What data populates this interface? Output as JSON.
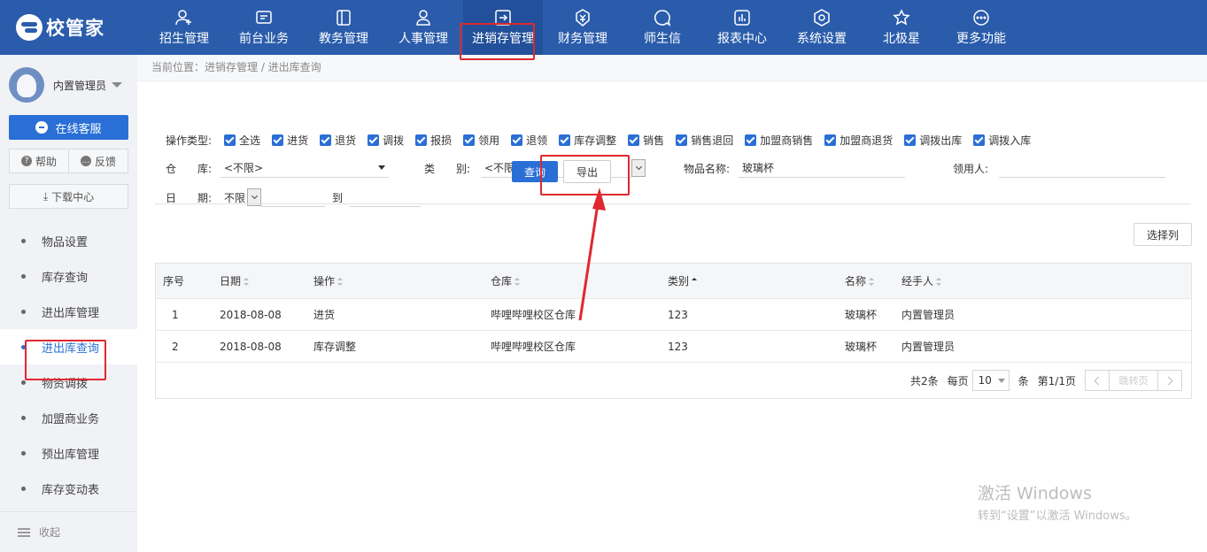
{
  "app": {
    "logo_text": "校管家"
  },
  "nav": [
    {
      "label": "招生管理",
      "icon": "add-user-icon"
    },
    {
      "label": "前台业务",
      "icon": "screen-icon"
    },
    {
      "label": "教务管理",
      "icon": "book-icon"
    },
    {
      "label": "人事管理",
      "icon": "person-icon"
    },
    {
      "label": "进销存管理",
      "icon": "exchange-icon",
      "active": true
    },
    {
      "label": "财务管理",
      "icon": "yuan-shield-icon"
    },
    {
      "label": "师生信",
      "icon": "chat-icon"
    },
    {
      "label": "报表中心",
      "icon": "report-icon"
    },
    {
      "label": "系统设置",
      "icon": "gear-icon"
    },
    {
      "label": "北极星",
      "icon": "star-icon"
    },
    {
      "label": "更多功能",
      "icon": "more-icon"
    }
  ],
  "sidebar": {
    "user_name": "内置管理员",
    "service_label": "在线客服",
    "help_label": "帮助",
    "feedback_label": "反馈",
    "download_label": "下载中心",
    "menu": [
      {
        "label": "物品设置"
      },
      {
        "label": "库存查询"
      },
      {
        "label": "进出库管理"
      },
      {
        "label": "进出库查询",
        "active": true
      },
      {
        "label": "物资调拨"
      },
      {
        "label": "加盟商业务"
      },
      {
        "label": "预出库管理"
      },
      {
        "label": "库存变动表"
      }
    ],
    "collapse_label": "收起"
  },
  "breadcrumb": "当前位置：进销存管理 / 进出库查询",
  "filters": {
    "op_type_label": "操作类型:",
    "op_types": [
      "全选",
      "进货",
      "退货",
      "调拨",
      "报损",
      "领用",
      "退领",
      "库存调整",
      "销售",
      "销售退回",
      "加盟商销售",
      "加盟商退货",
      "调拨出库",
      "调拨入库"
    ],
    "warehouse_label": "仓　　库:",
    "warehouse_value": "<不限>",
    "category_label": "类　　别:",
    "category_value": "<不限>",
    "item_name_label": "物品名称:",
    "item_name_value": "玻璃杯",
    "recipient_label": "领用人:",
    "recipient_value": "",
    "date_label": "日　　期:",
    "date_value": "不限",
    "to_label": "到",
    "query_label": "查询",
    "export_label": "导出"
  },
  "choose_columns_label": "选择列",
  "table": {
    "columns": [
      "序号",
      "日期",
      "操作",
      "仓库",
      "类别",
      "名称",
      "经手人"
    ],
    "rows": [
      [
        "1",
        "2018-08-08",
        "进货",
        "哔哩哔哩校区仓库",
        "123",
        "玻璃杯",
        "内置管理员"
      ],
      [
        "2",
        "2018-08-08",
        "库存调整",
        "哔哩哔哩校区仓库",
        "123",
        "玻璃杯",
        "内置管理员"
      ]
    ]
  },
  "pager": {
    "total": "共2条",
    "per_page_label": "每页",
    "per_page_value": "10",
    "unit": "条",
    "page_info": "第1/1页",
    "jump_label": "跳转页"
  },
  "watermark": {
    "line1": "激活 Windows",
    "line2": "转到“设置”以激活 Windows。"
  },
  "colors": {
    "nav_bg": "#2a5cab",
    "accent": "#2a6fd6",
    "highlight": "#e0282e"
  }
}
